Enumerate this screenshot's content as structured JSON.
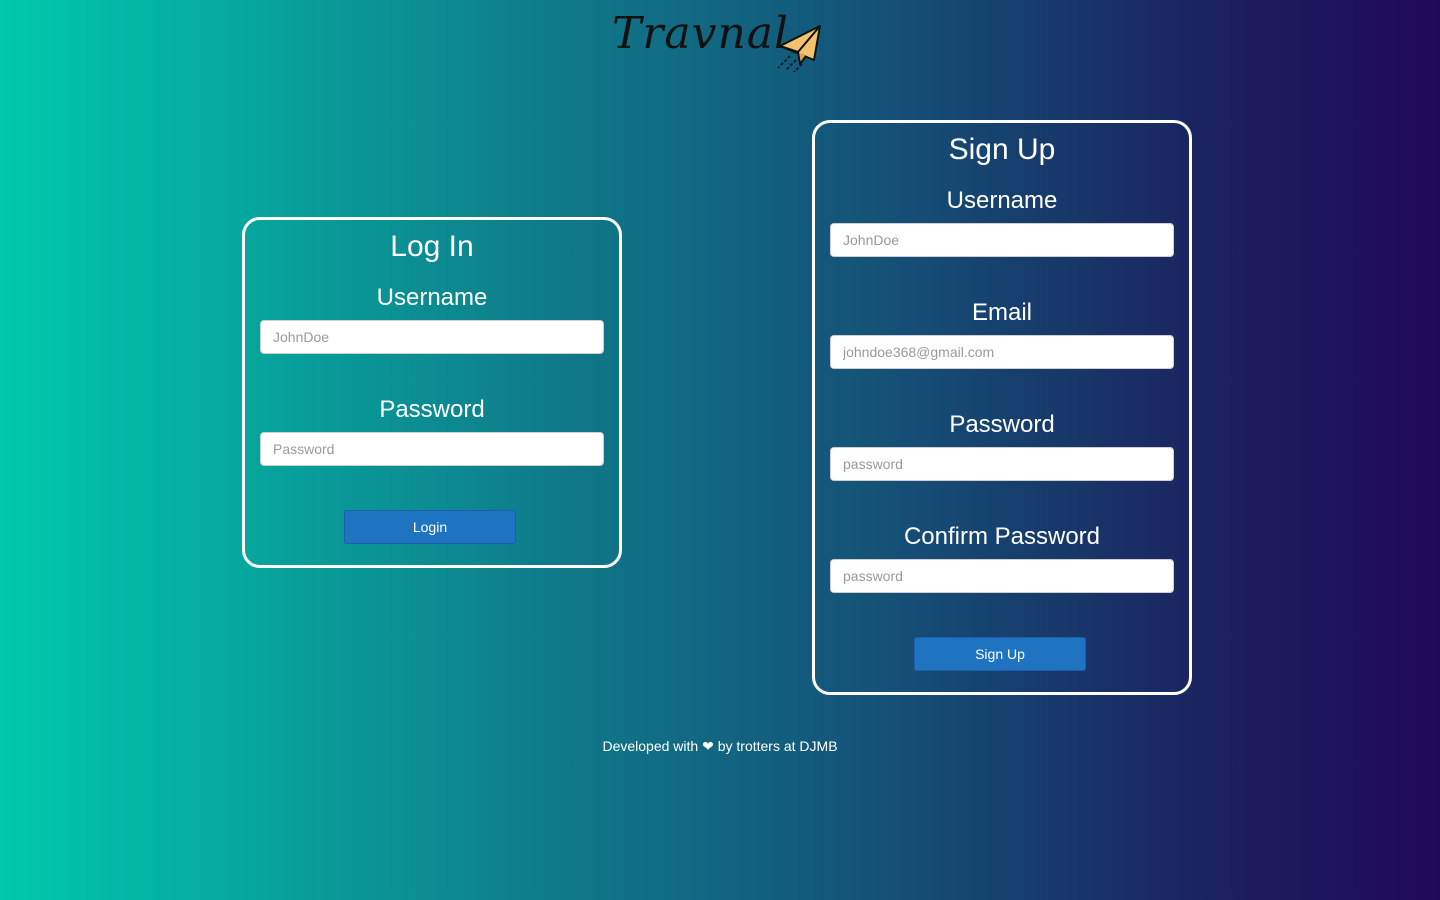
{
  "brand": {
    "name": "Travnal",
    "logo_icon": "paper-plane-icon"
  },
  "login": {
    "title": "Log In",
    "username_label": "Username",
    "username_placeholder": "JohnDoe",
    "password_label": "Password",
    "password_placeholder": "Password",
    "button_label": "Login"
  },
  "signup": {
    "title": "Sign Up",
    "username_label": "Username",
    "username_placeholder": "JohnDoe",
    "email_label": "Email",
    "email_placeholder": "johndoe368@gmail.com",
    "password_label": "Password",
    "password_placeholder": "password",
    "confirm_label": "Confirm Password",
    "confirm_placeholder": "password",
    "button_label": "Sign Up"
  },
  "footer": {
    "prefix": "Developed with",
    "heart_icon": "❤",
    "suffix": "by trotters at DJMB"
  },
  "colors": {
    "gradient_start": "#00c9ad",
    "gradient_end": "#21095a",
    "button": "#1e74c0",
    "card_border": "#ffffff"
  }
}
